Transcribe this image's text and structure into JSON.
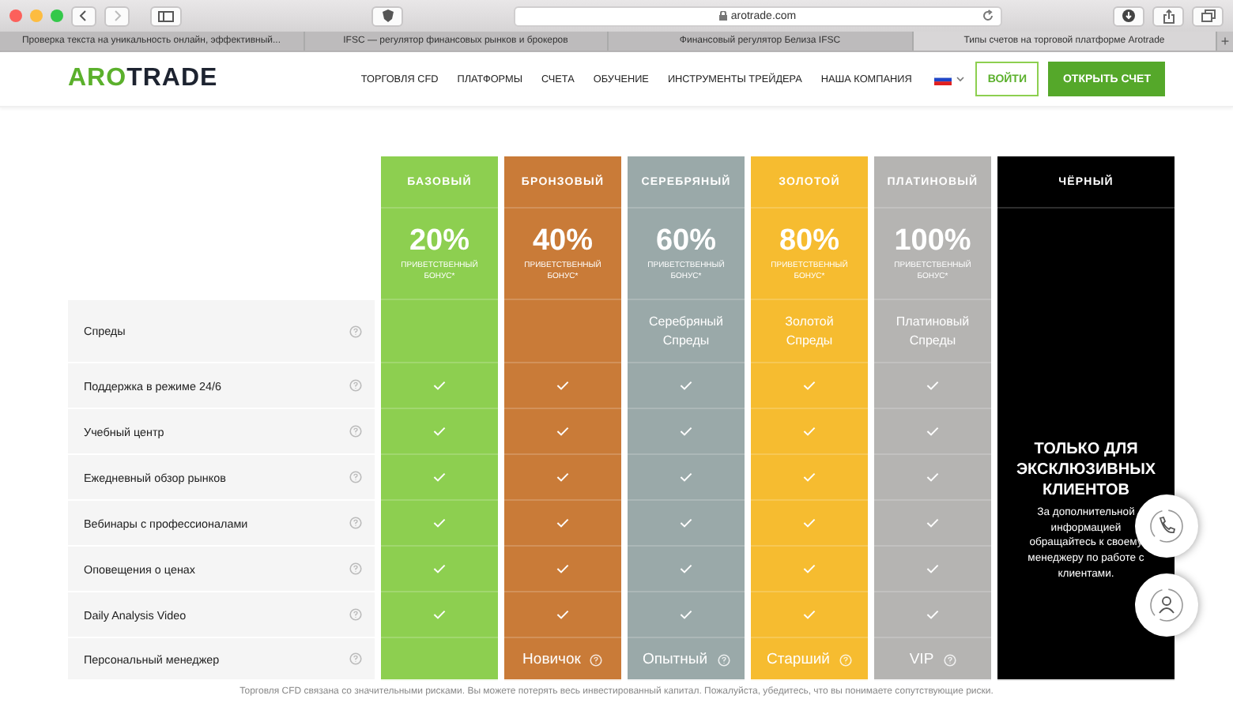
{
  "browser": {
    "address": "arotrade.com",
    "tabs": [
      {
        "title": "Проверка текста на уникальность онлайн, эффективный...",
        "selected": false
      },
      {
        "title": "IFSC — регулятор финансовых рынков и брокеров",
        "selected": false
      },
      {
        "title": "Финансовый регулятор Белиза IFSC",
        "selected": false
      },
      {
        "title": "Типы счетов на торговой платформе Arotrade",
        "selected": true
      }
    ],
    "new_tab": "+"
  },
  "header": {
    "logo": [
      "ARO",
      "TRADE"
    ],
    "nav": [
      "ТОРГОВЛЯ CFD",
      "ПЛАТФОРМЫ",
      "СЧЕТА",
      "ОБУЧЕНИЕ",
      "ИНСТРУМЕНТЫ ТРЕЙДЕРА",
      "НАША КОМПАНИЯ"
    ],
    "login": "ВОЙТИ",
    "open_account": "ОТКРЫТЬ СЧЕТ"
  },
  "rows": [
    {
      "label": "Спреды",
      "kind": "spreads"
    },
    {
      "label": "Поддержка в режиме 24/6",
      "kind": "check"
    },
    {
      "label": "Учебный центр",
      "kind": "check"
    },
    {
      "label": "Ежедневный обзор рынков",
      "kind": "check"
    },
    {
      "label": "Вебинары с профессионалами",
      "kind": "check"
    },
    {
      "label": "Оповещения о ценах",
      "kind": "check"
    },
    {
      "label": "Daily Analysis Video",
      "kind": "check"
    },
    {
      "label": "Персональный менеджер",
      "kind": "manager"
    }
  ],
  "plans": [
    {
      "name": "БАЗОВЫЙ",
      "kind": "standard",
      "color": "#8dcf50",
      "bonus": "20%",
      "bonus_label": "ПРИВЕТСТВЕННЫЙ БОНУС*",
      "checks": [
        true,
        true,
        true,
        true,
        true,
        true
      ]
    },
    {
      "name": "БРОНЗОВЫЙ",
      "kind": "standard",
      "color": "#c97b38",
      "bonus": "40%",
      "bonus_label": "ПРИВЕТСТВЕННЫЙ БОНУС*",
      "checks": [
        true,
        true,
        true,
        true,
        true,
        true
      ],
      "manager": "Новичок"
    },
    {
      "name": "СЕРЕБРЯНЫЙ",
      "kind": "standard",
      "color": "#9aa9a9",
      "bonus": "60%",
      "bonus_label": "ПРИВЕТСТВЕННЫЙ БОНУС*",
      "spreads": "Серебряный Спреды",
      "checks": [
        true,
        true,
        true,
        true,
        true,
        true
      ],
      "manager": "Опытный"
    },
    {
      "name": "ЗОЛОТОЙ",
      "kind": "standard",
      "color": "#f6bc30",
      "bonus": "80%",
      "bonus_label": "ПРИВЕТСТВЕННЫЙ БОНУС*",
      "spreads": "Золотой Спреды",
      "checks": [
        true,
        true,
        true,
        true,
        true,
        true
      ],
      "manager": "Старший"
    },
    {
      "name": "ПЛАТИНОВЫЙ",
      "kind": "standard",
      "color": "#b5b4b2",
      "bonus": "100%",
      "bonus_label": "ПРИВЕТСТВЕННЫЙ БОНУС*",
      "spreads": "Платиновый Спреды",
      "checks": [
        true,
        true,
        true,
        true,
        true,
        true
      ],
      "manager": "VIP"
    },
    {
      "name": "ЧЁРНЫЙ",
      "kind": "exclusive",
      "color": "#000000",
      "title": "ТОЛЬКО ДЛЯ ЭКСКЛЮЗИВНЫХ КЛИЕНТОВ",
      "text": "За дополнительной информацией обращайтесь к своему менеджеру по работе с клиентами."
    }
  ],
  "disclaimer": "Торговля CFD связана со значительными рисками. Вы можете потерять весь инвестированный капитал. Пожалуйста, убедитесь, что вы понимаете сопутствующие риски."
}
